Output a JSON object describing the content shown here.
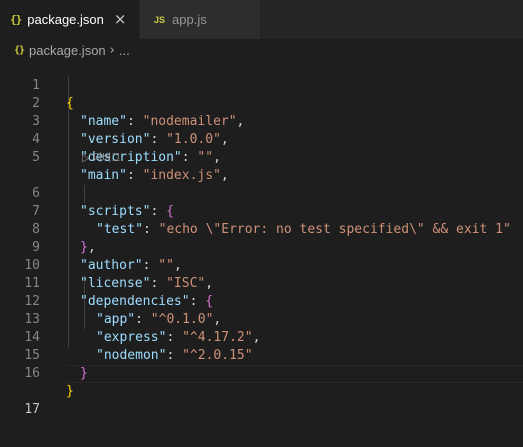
{
  "tabs": {
    "active": {
      "icon": "{}",
      "label": "package.json",
      "close": "×"
    },
    "inactive": {
      "icon": "JS",
      "label": "app.js"
    }
  },
  "breadcrumb": {
    "icon": "{}",
    "file": "package.json",
    "separator": "›",
    "more": "..."
  },
  "codelens": {
    "label": "▷ 디버그"
  },
  "line_numbers": [
    "1",
    "2",
    "3",
    "4",
    "5",
    "6",
    "7",
    "8",
    "9",
    "10",
    "11",
    "12",
    "13",
    "14",
    "15",
    "16",
    "17"
  ],
  "code": {
    "l1": {
      "open": "{"
    },
    "l2": {
      "key": "\"name\"",
      "colon": ": ",
      "val": "\"nodemailer\"",
      "comma": ","
    },
    "l3": {
      "key": "\"version\"",
      "colon": ": ",
      "val": "\"1.0.0\"",
      "comma": ","
    },
    "l4": {
      "key": "\"description\"",
      "colon": ": ",
      "val": "\"\"",
      "comma": ","
    },
    "l5": {
      "key": "\"main\"",
      "colon": ": ",
      "val": "\"index.js\"",
      "comma": ","
    },
    "l6": {
      "key": "\"scripts\"",
      "colon": ": ",
      "open": "{"
    },
    "l7": {
      "key": "\"test\"",
      "colon": ": ",
      "val": "\"echo \\\"Error: no test specified\\\" && exit 1\""
    },
    "l8": {
      "close": "}",
      "comma": ","
    },
    "l9": {
      "key": "\"author\"",
      "colon": ": ",
      "val": "\"\"",
      "comma": ","
    },
    "l10": {
      "key": "\"license\"",
      "colon": ": ",
      "val": "\"ISC\"",
      "comma": ","
    },
    "l11": {
      "key": "\"dependencies\"",
      "colon": ": ",
      "open": "{"
    },
    "l12": {
      "key": "\"app\"",
      "colon": ": ",
      "val": "\"^0.1.0\"",
      "comma": ","
    },
    "l13": {
      "key": "\"express\"",
      "colon": ": ",
      "val": "\"^4.17.2\"",
      "comma": ","
    },
    "l14": {
      "key": "\"nodemon\"",
      "colon": ": ",
      "val": "\"^2.0.15\""
    },
    "l15": {
      "close": "}"
    },
    "l16": {
      "close": "}"
    }
  },
  "colors": {
    "background": "#1e1e1e",
    "key": "#9cdcfe",
    "string": "#ce9178",
    "bracket_outer": "#ffd700",
    "bracket_inner": "#da70d6",
    "line_number": "#858585"
  }
}
